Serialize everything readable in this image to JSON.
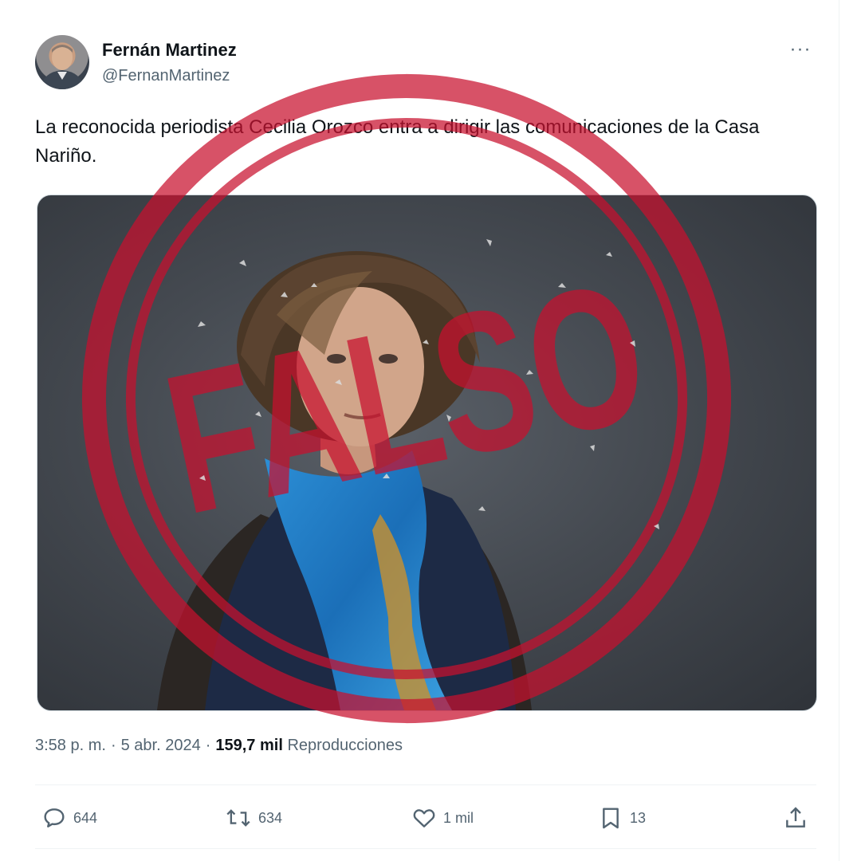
{
  "author": {
    "name": "Fernán Martinez",
    "handle": "@FernanMartinez"
  },
  "more_label": "···",
  "tweet_text": "La reconocida periodista Cecilia Orozco entra a dirigir las comunicaciones de la Casa Nariño.",
  "meta": {
    "time": "3:58 p. m.",
    "separator": "·",
    "date": "5 abr. 2024",
    "views_count": "159,7 mil",
    "views_label": "Reproducciones"
  },
  "actions": {
    "replies": "644",
    "retweets": "634",
    "likes": "1 mil",
    "bookmarks": "13"
  },
  "stamp": {
    "text": "FALSO",
    "color": "#c8102e"
  },
  "icons": {
    "reply": "reply-icon",
    "retweet": "retweet-icon",
    "like": "heart-icon",
    "bookmark": "bookmark-icon",
    "share": "share-icon",
    "more": "more-icon"
  }
}
